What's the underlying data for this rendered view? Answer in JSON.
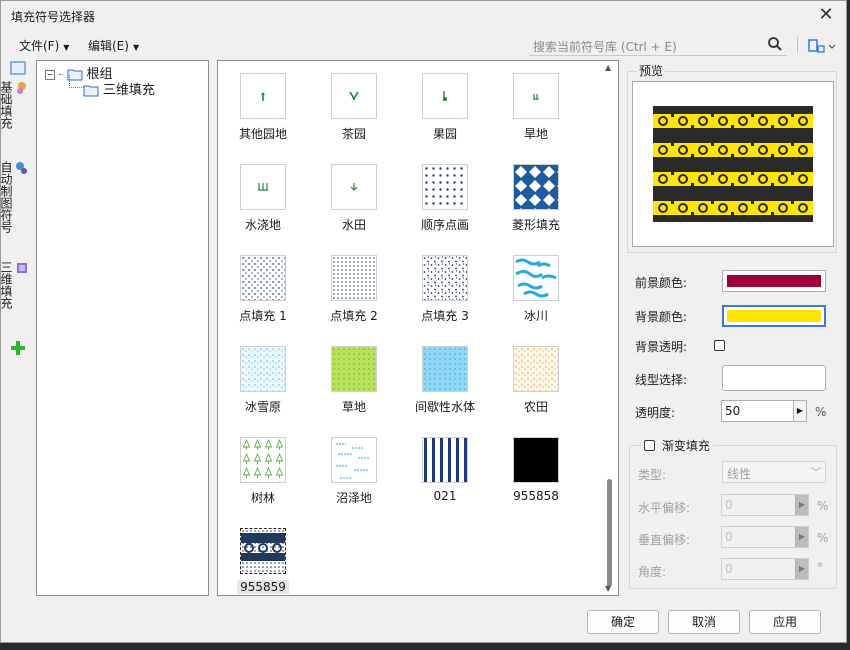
{
  "window": {
    "title": "填充符号选择器"
  },
  "menus": [
    {
      "label": "文件(F)"
    },
    {
      "label": "编辑(E)"
    }
  ],
  "search": {
    "placeholder": "搜索当前符号库 (Ctrl + E)"
  },
  "sidebar": {
    "tabs": [
      {
        "label": "基础填充",
        "icon": "fill-icon"
      },
      {
        "label": "自动制图符号",
        "icon": "cartography-icon"
      },
      {
        "label": "三维填充",
        "icon": "3d-icon"
      }
    ]
  },
  "tree": {
    "root": "根组",
    "child": "三维填充"
  },
  "symbols": [
    {
      "label": "其他园地"
    },
    {
      "label": "茶园"
    },
    {
      "label": "果园"
    },
    {
      "label": "旱地"
    },
    {
      "label": "水浇地"
    },
    {
      "label": "水田"
    },
    {
      "label": "顺序点画"
    },
    {
      "label": "菱形填充"
    },
    {
      "label": "点填充 1"
    },
    {
      "label": "点填充 2"
    },
    {
      "label": "点填充 3"
    },
    {
      "label": "冰川"
    },
    {
      "label": "冰雪原"
    },
    {
      "label": "草地"
    },
    {
      "label": "间歇性水体"
    },
    {
      "label": "农田"
    },
    {
      "label": "树林"
    },
    {
      "label": "沼泽地"
    },
    {
      "label": "021"
    },
    {
      "label": "955858"
    },
    {
      "label": "955859"
    }
  ],
  "preview": {
    "title": "预览"
  },
  "properties": {
    "fg_label": "前景颜色:",
    "fg_color": "#a0003a",
    "bg_label": "背景颜色:",
    "bg_color": "#ffe600",
    "bg_transparent_label": "背景透明:",
    "linetype_label": "线型选择:",
    "opacity_label": "透明度:",
    "opacity_value": "50",
    "opacity_unit": "%"
  },
  "gradient": {
    "label": "渐变填充",
    "type_label": "类型:",
    "type_value": "线性",
    "hoffset_label": "水平偏移:",
    "hoffset_value": "0",
    "voffset_label": "垂直偏移:",
    "voffset_value": "0",
    "angle_label": "角度:",
    "angle_value": "0",
    "percent": "%",
    "degree": "°"
  },
  "buttons": {
    "ok": "确定",
    "cancel": "取消",
    "apply": "应用"
  }
}
